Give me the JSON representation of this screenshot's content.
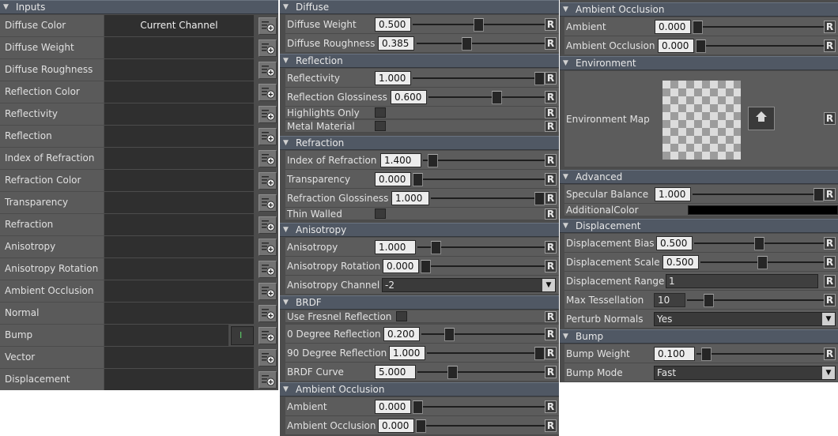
{
  "inputs": {
    "title": "Inputs",
    "rows": [
      {
        "label": "Diffuse Color",
        "value": "Current Channel"
      },
      {
        "label": "Diffuse Weight",
        "value": ""
      },
      {
        "label": "Diffuse Roughness",
        "value": ""
      },
      {
        "label": "Reflection Color",
        "value": ""
      },
      {
        "label": "Reflectivity",
        "value": ""
      },
      {
        "label": "Reflection Glossiness",
        "value": ""
      },
      {
        "label": "Index of Refraction",
        "value": ""
      },
      {
        "label": "Refraction Color",
        "value": ""
      },
      {
        "label": "Transparency",
        "value": ""
      },
      {
        "label": "Refraction Glossiness",
        "value": ""
      },
      {
        "label": "Anisotropy",
        "value": ""
      },
      {
        "label": "Anisotropy Rotation",
        "value": ""
      },
      {
        "label": "Ambient Occlusion",
        "value": ""
      },
      {
        "label": "Normal",
        "value": ""
      },
      {
        "label": "Bump",
        "value": "",
        "toggle": "I"
      },
      {
        "label": "Vector",
        "value": ""
      },
      {
        "label": "Displacement",
        "value": ""
      }
    ]
  },
  "reset_label": "R",
  "mid": {
    "diffuse": {
      "title": "Diffuse",
      "weight_label": "Diffuse Weight",
      "weight": "0.500",
      "weight_level": 0.5,
      "rough_label": "Diffuse Roughness",
      "rough": "0.385",
      "rough_level": 0.385
    },
    "reflection": {
      "title": "Reflection",
      "reflectivity_label": "Reflectivity",
      "reflectivity": "1.000",
      "reflectivity_level": 1.0,
      "gloss_label": "Reflection Glossiness",
      "gloss": "0.600",
      "gloss_level": 0.6,
      "highlights_label": "Highlights Only",
      "metal_label": "Metal Material"
    },
    "refraction": {
      "title": "Refraction",
      "ior_label": "Index of Refraction",
      "ior": "1.400",
      "ior_level": 0.03,
      "transp_label": "Transparency",
      "transp": "0.000",
      "transp_level": 0.0,
      "gloss_label": "Refraction Glossiness",
      "gloss": "1.000",
      "gloss_level": 1.0,
      "thin_label": "Thin Walled"
    },
    "anisotropy": {
      "title": "Anisotropy",
      "aniso_label": "Anisotropy",
      "aniso": "1.000",
      "aniso_level": 0.06,
      "rot_label": "Anisotropy Rotation",
      "rot": "0.000",
      "rot_level": 0.0,
      "chan_label": "Anisotropy Channel",
      "chan": "-2"
    },
    "brdf": {
      "title": "BRDF",
      "fresnel_label": "Use Fresnel Reflection",
      "deg0_label": "0 Degree Reflection",
      "deg0": "0.200",
      "deg0_level": 0.2,
      "deg90_label": "90 Degree Reflection",
      "deg90": "1.000",
      "deg90_level": 1.0,
      "curve_label": "BRDF Curve",
      "curve": "5.000",
      "curve_level": 0.26
    },
    "ao": {
      "title": "Ambient Occlusion",
      "ambient_label": "Ambient",
      "ambient": "0.000",
      "ambient_level": 0.0,
      "occ_label": "Ambient Occlusion",
      "occ": "0.000",
      "occ_level": 0.0
    }
  },
  "right": {
    "ao": {
      "title": "Ambient Occlusion",
      "ambient_label": "Ambient",
      "ambient": "0.000",
      "ambient_level": 0.0,
      "occ_label": "Ambient Occlusion",
      "occ": "0.000",
      "occ_level": 0.0
    },
    "env": {
      "title": "Environment",
      "map_label": "Environment Map"
    },
    "advanced": {
      "title": "Advanced",
      "spec_label": "Specular Balance",
      "spec": "1.000",
      "spec_level": 1.0,
      "addcolor_label": "AdditionalColor",
      "addcolor": "#000000"
    },
    "displacement": {
      "title": "Displacement",
      "bias_label": "Displacement Bias",
      "bias": "0.500",
      "bias_level": 0.5,
      "scale_label": "Displacement Scale",
      "scale": "0.500",
      "scale_level": 0.5,
      "range_label": "Displacement Range",
      "range": "1",
      "tess_label": "Max Tessellation",
      "tess": "10",
      "tess_level": 0.1,
      "perturb_label": "Perturb Normals",
      "perturb": "Yes"
    },
    "bump": {
      "title": "Bump",
      "weight_label": "Bump Weight",
      "weight": "0.100",
      "weight_level": 0.02,
      "mode_label": "Bump Mode",
      "mode": "Fast"
    }
  }
}
